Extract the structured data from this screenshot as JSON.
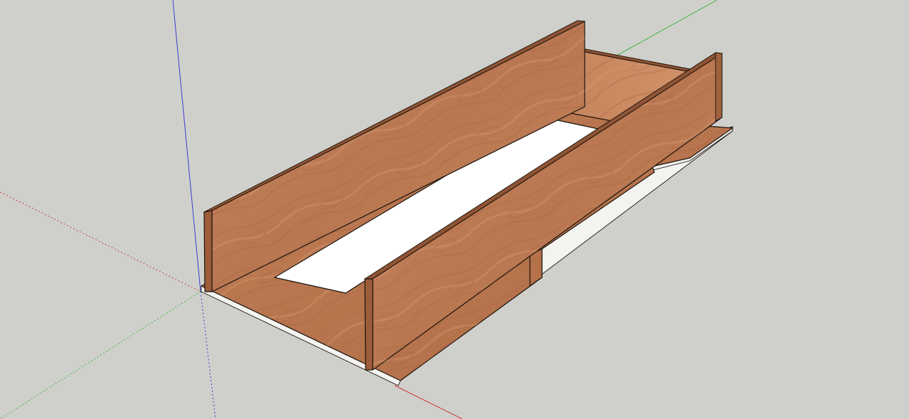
{
  "viewport": {
    "background_color": "#cfd0cb"
  },
  "axes": {
    "red_axis_color": "#d23a3a",
    "green_axis_color": "#3fb43f",
    "blue_axis_color": "#3a3ad2"
  },
  "model": {
    "wood_light_color": "#c8845c",
    "wood_mid_color": "#b5714a",
    "wood_dark_color": "#8e5434",
    "board_edge_color": "#f3f3f0"
  }
}
